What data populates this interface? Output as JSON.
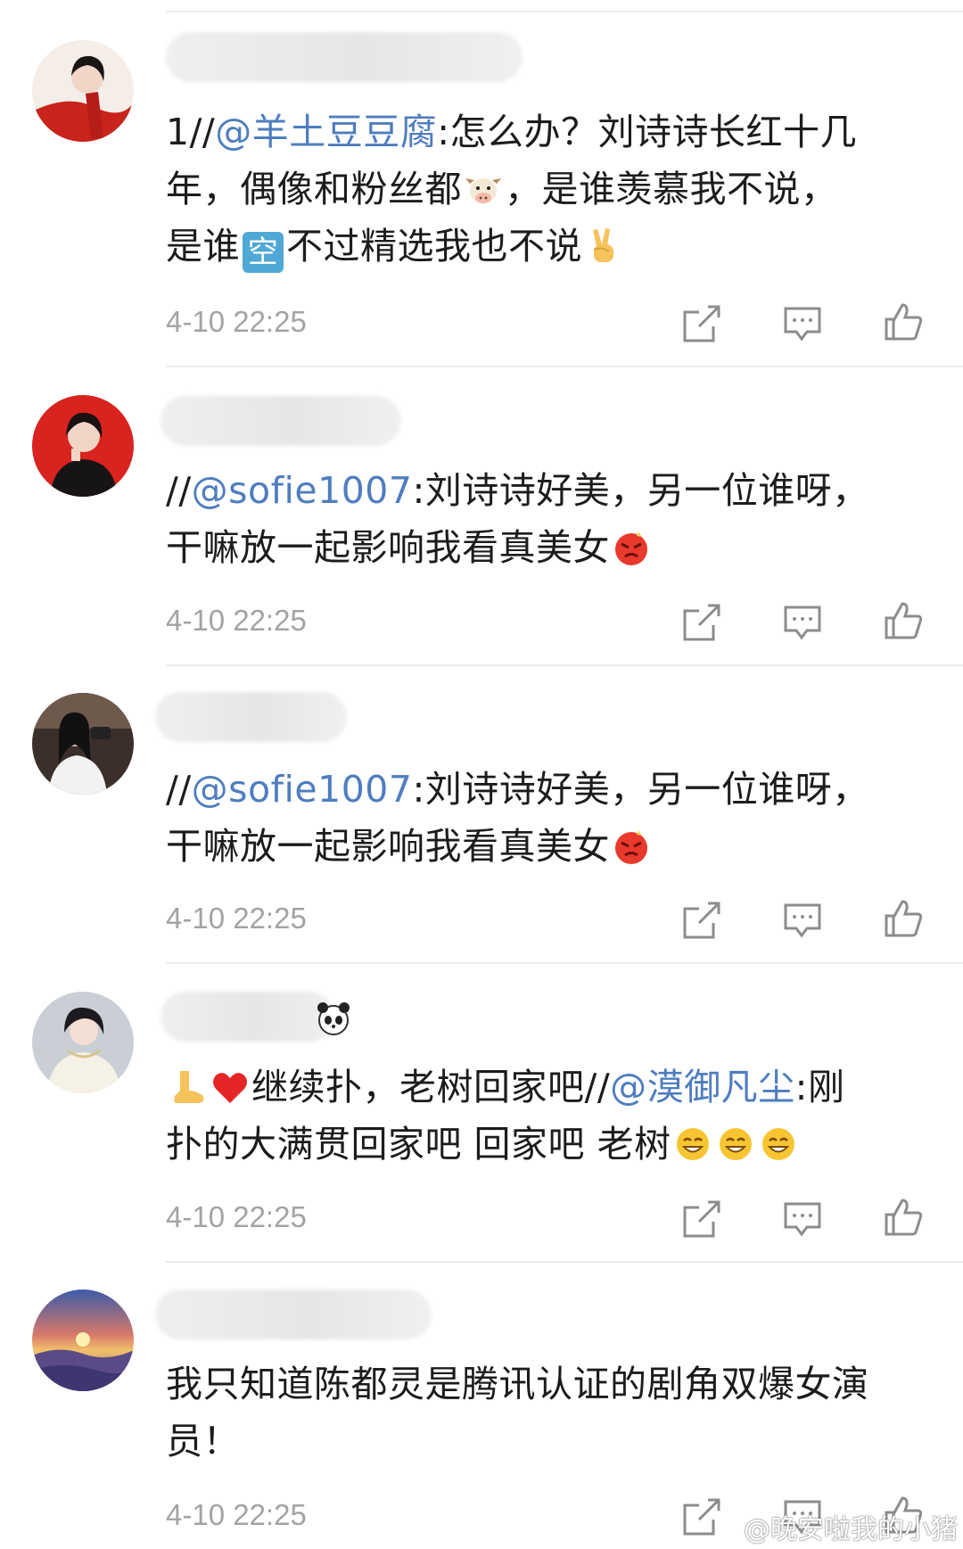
{
  "comments": [
    {
      "text_before": "1//",
      "mention": "@羊土豆豆腐",
      "text_line1": ":怎么办？刘诗诗长红十几",
      "text_line2a": "年，偶像和粉丝都",
      "text_line2b": "，是谁羡慕我不说，",
      "text_line3a": "是谁",
      "kong": "空",
      "text_line3b": "不过精选我也不说",
      "timestamp": "4-10 22:25"
    },
    {
      "text_before": "//",
      "mention": "@sofie1007",
      "text_line1": ":刘诗诗好美，另一位谁呀，",
      "text_line2": "干嘛放一起影响我看真美女",
      "timestamp": "4-10 22:25"
    },
    {
      "text_before": "//",
      "mention": "@sofie1007",
      "text_line1": ":刘诗诗好美，另一位谁呀，",
      "text_line2": "干嘛放一起影响我看真美女",
      "timestamp": "4-10 22:25"
    },
    {
      "text_line1a": "继续扑，老树回家吧//",
      "mention": "@漠御凡尘",
      "text_line1b": ":刚",
      "text_line2": "扑的大满贯回家吧 回家吧 老树",
      "timestamp": "4-10 22:25"
    },
    {
      "text_line1": "我只知道陈都灵是腾讯认证的剧角双爆女演",
      "text_line2": "员！",
      "timestamp": "4-10 22:25"
    }
  ],
  "icons": {
    "share": "share-icon",
    "comment": "comment-icon",
    "like": "thumbs-up-icon"
  },
  "colors": {
    "mention": "#4f7dbf",
    "text": "#1c1c1c",
    "timestamp": "#a3a3a3",
    "divider": "#ececec"
  },
  "watermark": "@晚安啦我的小猪"
}
